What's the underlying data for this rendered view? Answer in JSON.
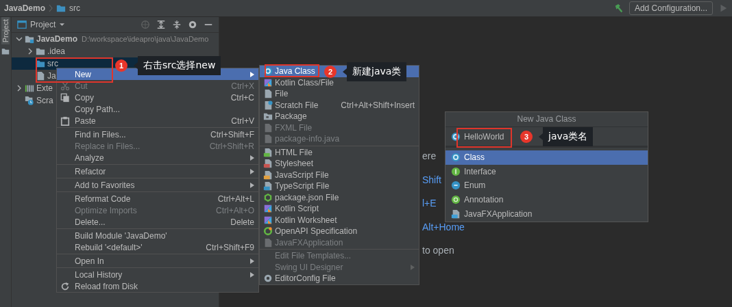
{
  "breadcrumbs": [
    {
      "label": "JavaDemo",
      "kind": "project"
    },
    {
      "label": "src",
      "kind": "folder"
    }
  ],
  "toolbar": {
    "run_configuration_button": "Add Configuration..."
  },
  "tool_stripe": {
    "label": "Project"
  },
  "project_panel": {
    "title": "Project",
    "tree": [
      {
        "label": "JavaDemo",
        "path": "D:\\workspace\\ideapro\\java\\JavaDemo",
        "kind": "module",
        "expanded": true,
        "selected": false,
        "children": [
          {
            "label": ".idea",
            "kind": "folder",
            "expanded": false,
            "selected": false
          },
          {
            "label": "src",
            "kind": "source",
            "selected": true
          },
          {
            "label": "Ja",
            "kind": "file",
            "selected": false
          }
        ]
      },
      {
        "label": "Exte",
        "kind": "libraries",
        "expanded": false,
        "selected": false
      },
      {
        "label": "Scra",
        "kind": "scratches",
        "selected": false
      }
    ]
  },
  "editor_hints": [
    {
      "text": "ere",
      "kind": "text"
    },
    {
      "text": "Shift",
      "kind": "shortcut"
    },
    {
      "text": "l+E",
      "kind": "shortcut"
    },
    {
      "text": "Alt+Home",
      "kind": "shortcut"
    },
    {
      "text": "to open",
      "kind": "text"
    }
  ],
  "context_menu": {
    "items": [
      {
        "kind": "item",
        "label": "New",
        "submenu": true,
        "selected": true,
        "disabled": false
      },
      {
        "kind": "cut",
        "label": "Cut",
        "shortcut": "Ctrl+X",
        "selected": false,
        "disabled": true
      },
      {
        "kind": "copy",
        "label": "Copy",
        "shortcut": "Ctrl+C",
        "selected": false,
        "disabled": false
      },
      {
        "kind": "item",
        "label": "Copy Path...",
        "selected": false,
        "disabled": false
      },
      {
        "kind": "paste",
        "label": "Paste",
        "shortcut": "Ctrl+V",
        "selected": false,
        "disabled": false
      },
      {
        "kind": "separator"
      },
      {
        "kind": "item",
        "label": "Find in Files...",
        "shortcut": "Ctrl+Shift+F",
        "selected": false,
        "disabled": false
      },
      {
        "kind": "item",
        "label": "Replace in Files...",
        "shortcut": "Ctrl+Shift+R",
        "selected": false,
        "disabled": true
      },
      {
        "kind": "item",
        "label": "Analyze",
        "submenu": true,
        "selected": false,
        "disabled": false
      },
      {
        "kind": "separator"
      },
      {
        "kind": "item",
        "label": "Refactor",
        "submenu": true,
        "selected": false,
        "disabled": false
      },
      {
        "kind": "separator"
      },
      {
        "kind": "item",
        "label": "Add to Favorites",
        "submenu": true,
        "selected": false,
        "disabled": false
      },
      {
        "kind": "separator"
      },
      {
        "kind": "item",
        "label": "Reformat Code",
        "shortcut": "Ctrl+Alt+L",
        "selected": false,
        "disabled": false
      },
      {
        "kind": "item",
        "label": "Optimize Imports",
        "shortcut": "Ctrl+Alt+O",
        "selected": false,
        "disabled": true
      },
      {
        "kind": "item",
        "label": "Delete...",
        "shortcut": "Delete",
        "selected": false,
        "disabled": false
      },
      {
        "kind": "separator"
      },
      {
        "kind": "item",
        "label": "Build Module 'JavaDemo'",
        "selected": false,
        "disabled": false
      },
      {
        "kind": "item",
        "label": "Rebuild '<default>'",
        "shortcut": "Ctrl+Shift+F9",
        "selected": false,
        "disabled": false
      },
      {
        "kind": "separator"
      },
      {
        "kind": "item",
        "label": "Open In",
        "submenu": true,
        "selected": false,
        "disabled": false
      },
      {
        "kind": "separator"
      },
      {
        "kind": "item",
        "label": "Local History",
        "submenu": true,
        "selected": false,
        "disabled": false
      },
      {
        "kind": "reload",
        "label": "Reload from Disk",
        "selected": false,
        "disabled": false
      }
    ]
  },
  "new_submenu": {
    "items": [
      {
        "kind": "class",
        "label": "Java Class",
        "selected": true,
        "disabled": false
      },
      {
        "kind": "kotlin",
        "label": "Kotlin Class/File",
        "selected": false,
        "disabled": false
      },
      {
        "kind": "file",
        "label": "File",
        "selected": false,
        "disabled": false
      },
      {
        "kind": "scratch",
        "label": "Scratch File",
        "shortcut": "Ctrl+Alt+Shift+Insert",
        "selected": false,
        "disabled": false
      },
      {
        "kind": "package",
        "label": "Package",
        "selected": false,
        "disabled": false
      },
      {
        "kind": "file",
        "label": "FXML File",
        "selected": false,
        "disabled": true
      },
      {
        "kind": "file",
        "label": "package-info.java",
        "selected": false,
        "disabled": true
      },
      {
        "kind": "separator"
      },
      {
        "kind": "html",
        "label": "HTML File",
        "selected": false,
        "disabled": false
      },
      {
        "kind": "css",
        "label": "Stylesheet",
        "selected": false,
        "disabled": false
      },
      {
        "kind": "js",
        "label": "JavaScript File",
        "selected": false,
        "disabled": false
      },
      {
        "kind": "ts",
        "label": "TypeScript File",
        "selected": false,
        "disabled": false
      },
      {
        "kind": "npm",
        "label": "package.json File",
        "selected": false,
        "disabled": false
      },
      {
        "kind": "kotlin",
        "label": "Kotlin Script",
        "selected": false,
        "disabled": false
      },
      {
        "kind": "kotlin",
        "label": "Kotlin Worksheet",
        "selected": false,
        "disabled": false
      },
      {
        "kind": "openapi",
        "label": "OpenAPI Specification",
        "selected": false,
        "disabled": false
      },
      {
        "kind": "file",
        "label": "JavaFXApplication",
        "selected": false,
        "disabled": true
      },
      {
        "kind": "separator"
      },
      {
        "kind": "none",
        "label": "Edit File Templates...",
        "selected": false,
        "disabled": true
      },
      {
        "kind": "none",
        "label": "Swing UI Designer",
        "submenu": true,
        "selected": false,
        "disabled": true
      },
      {
        "kind": "gear",
        "label": "EditorConfig File",
        "selected": false,
        "disabled": false
      }
    ]
  },
  "new_class_popup": {
    "title": "New Java Class",
    "name_field": {
      "value": "HelloWorld"
    },
    "options": [
      {
        "label": "Class",
        "kind": "class",
        "selected": true
      },
      {
        "label": "Interface",
        "kind": "interface",
        "selected": false
      },
      {
        "label": "Enum",
        "kind": "enum",
        "selected": false
      },
      {
        "label": "Annotation",
        "kind": "annotation",
        "selected": false
      },
      {
        "label": "JavaFXApplication",
        "kind": "javafx",
        "selected": false
      }
    ]
  },
  "annotations": [
    {
      "number": "1",
      "text": "右击src选择new"
    },
    {
      "number": "2",
      "text": "新建java类"
    },
    {
      "number": "3",
      "text": "java类名"
    }
  ]
}
